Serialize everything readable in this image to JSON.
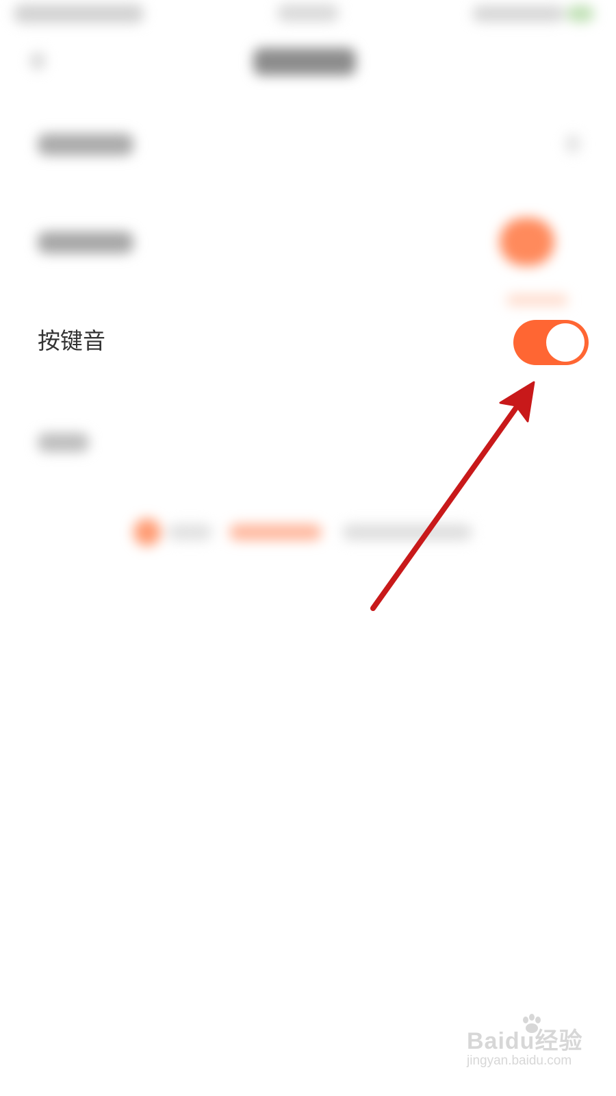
{
  "settings": {
    "key_sound": {
      "label": "按键音",
      "enabled": true
    }
  },
  "colors": {
    "accent": "#ff6633",
    "annotation_arrow": "#c8191a",
    "label_text": "#333333"
  },
  "watermark": {
    "brand": "Baidu经验",
    "url": "jingyan.baidu.com"
  }
}
